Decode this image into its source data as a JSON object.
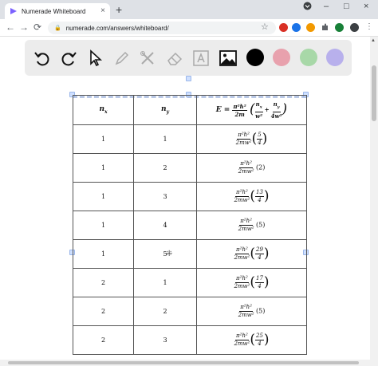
{
  "browser": {
    "tab_title": "Numerade Whiteboard",
    "tab_close": "×",
    "new_tab": "+",
    "url": "numerade.com/answers/whiteboard/",
    "window_controls": [
      "⌄",
      "–",
      "□",
      "×"
    ],
    "nav": {
      "back": "←",
      "forward": "→",
      "reload": "⟳",
      "bookmark": "☆"
    },
    "extensions": [
      {
        "name": "red-extension-icon",
        "color": "#d93025",
        "badge": ""
      },
      {
        "name": "blue-extension-icon",
        "color": "#1a73e8",
        "badge": ""
      },
      {
        "name": "orange-extension-icon",
        "color": "#f29900",
        "badge": ""
      },
      {
        "name": "puzzle-extension-icon",
        "color": "#5f6368",
        "badge": ""
      },
      {
        "name": "green-extension-icon",
        "color": "#188038",
        "badge": ""
      },
      {
        "name": "profile-avatar-icon",
        "color": "#3c4043",
        "badge": ""
      }
    ]
  },
  "whiteboard_tools": {
    "items": [
      "undo-icon",
      "redo-icon",
      "select-pointer-icon",
      "pen-icon",
      "tools-icon",
      "eraser-icon",
      "text-icon",
      "image-icon"
    ],
    "colors": [
      "#000000",
      "#e8a1ad",
      "#a8d8a8",
      "#b8b0ec"
    ]
  },
  "table": {
    "headers": {
      "nx": "n",
      "nx_sub": "x",
      "ny": "n",
      "ny_sub": "y",
      "energy_lhs": "E =",
      "energy_num": "π²ℏ²",
      "energy_den": "2m",
      "term1_num": "n",
      "term1_num_sub": "x",
      "term1_den": "w²",
      "plus": "+",
      "term2_num": "n",
      "term2_num_sub": "y",
      "term2_den": "4w²"
    },
    "prefactor_num": "π²ℏ²",
    "prefactor_den": "2mw²",
    "rows": [
      {
        "nx": "1",
        "ny": "1",
        "factor_num": "5",
        "factor_den": "4"
      },
      {
        "nx": "1",
        "ny": "2",
        "factor": "(2)"
      },
      {
        "nx": "1",
        "ny": "3",
        "factor_num": "13",
        "factor_den": "4"
      },
      {
        "nx": "1",
        "ny": "4",
        "factor": "(5)"
      },
      {
        "nx": "1",
        "ny": "5",
        "factor_num": "29",
        "factor_den": "4"
      },
      {
        "nx": "2",
        "ny": "1",
        "factor_num": "17",
        "factor_den": "4"
      },
      {
        "nx": "2",
        "ny": "2",
        "factor": "(5)"
      },
      {
        "nx": "2",
        "ny": "3",
        "factor_num": "25",
        "factor_den": "4"
      }
    ]
  }
}
